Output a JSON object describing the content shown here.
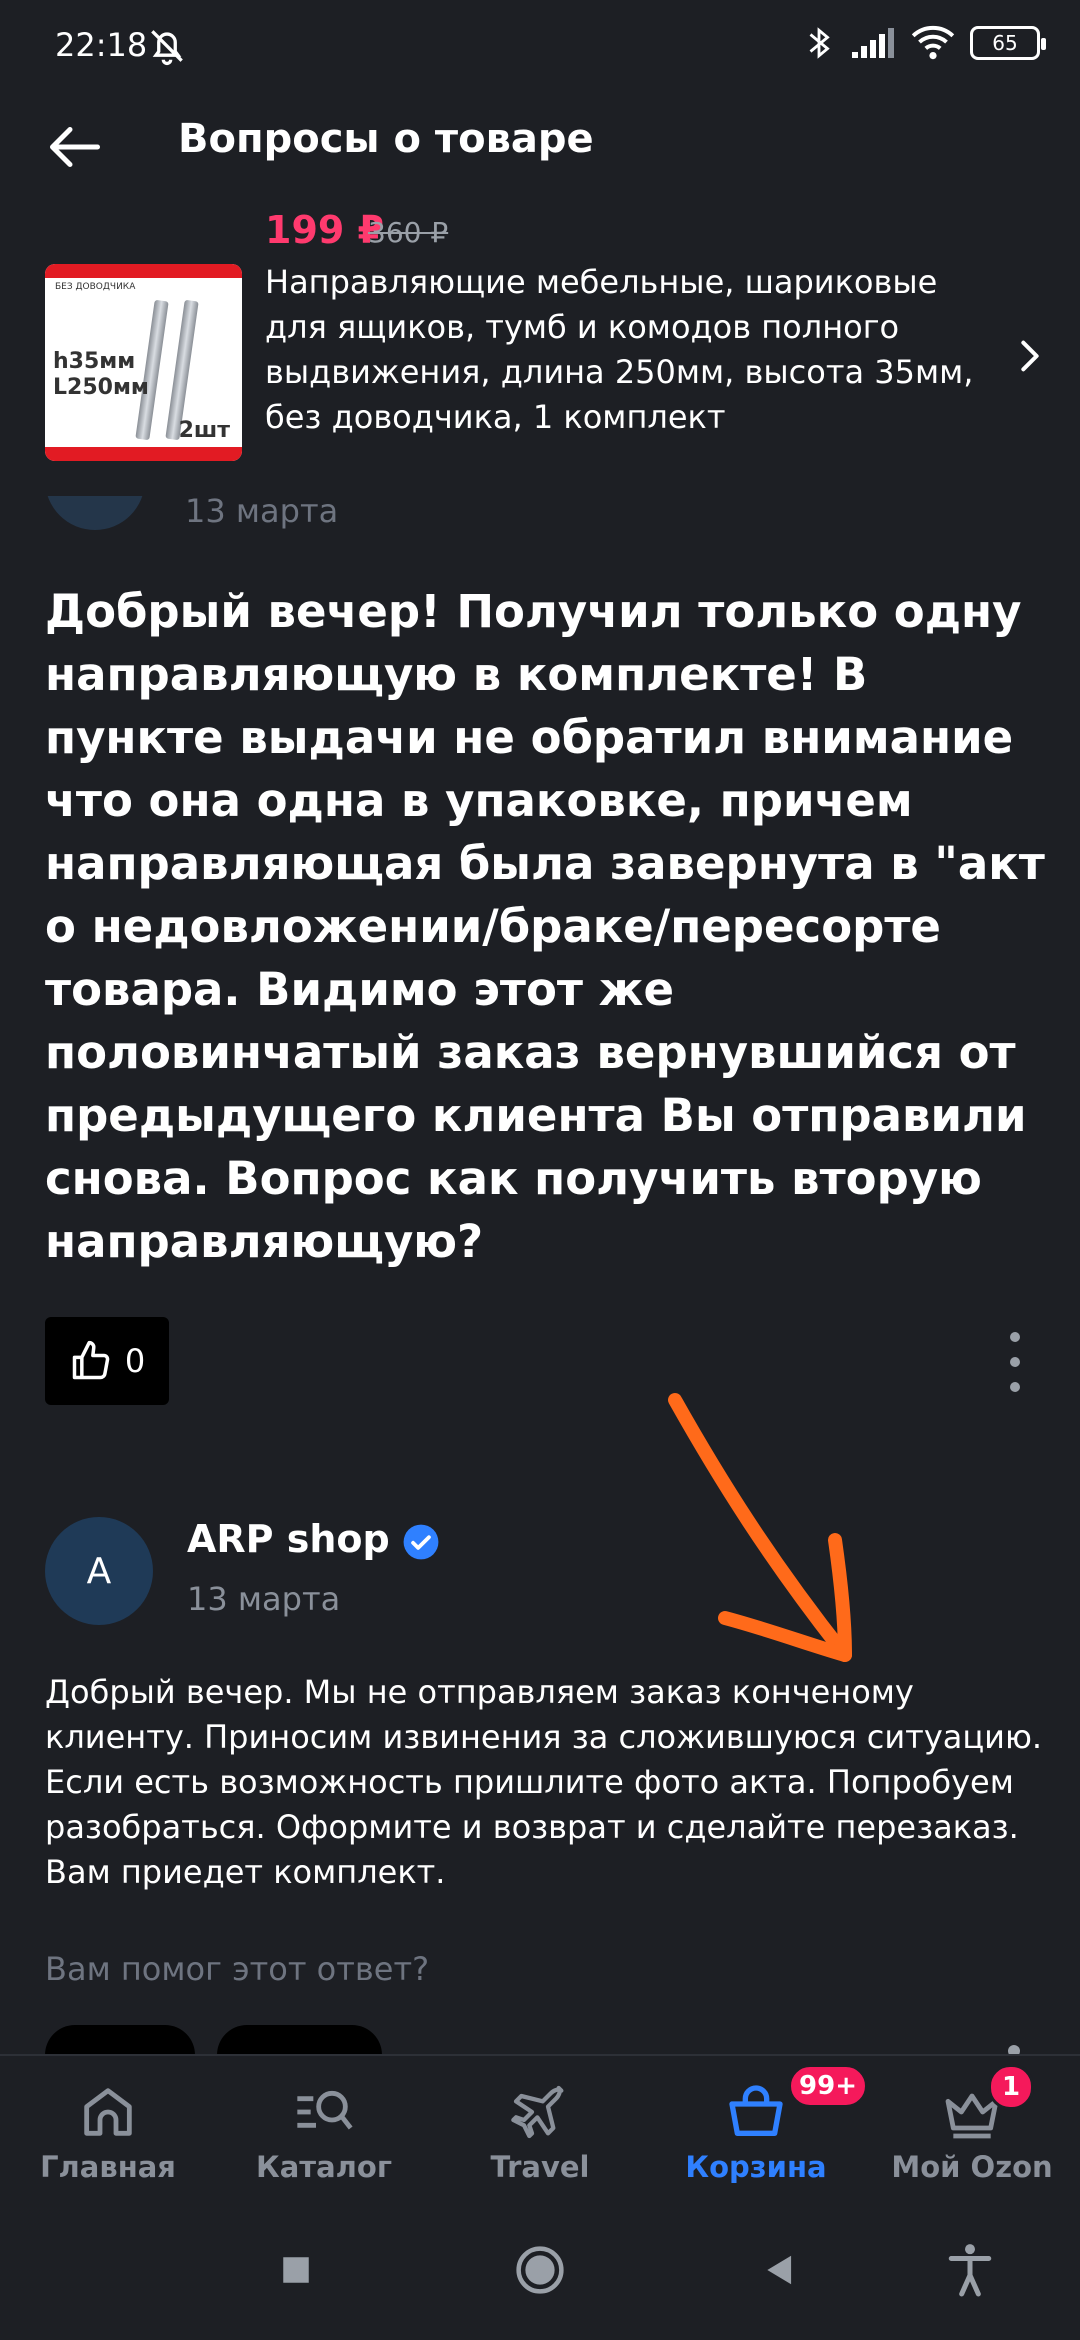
{
  "status_bar": {
    "time": "22:18",
    "battery": "65"
  },
  "header": {
    "title": "Вопросы о товаре"
  },
  "product": {
    "price": "199 ₽",
    "old_price": "360 ₽",
    "title": "Направляющие мебельные, шариковые для ящиков, тумб и комодов полного выдвижения, длина 250мм, высота 35мм, без доводчика,  1 комплект",
    "image_label": "БЕЗ ДОВОДЧИКА",
    "image_dim_h": "h35мм",
    "image_dim_l": "L250мм",
    "image_qty": "2шт"
  },
  "question": {
    "partial_date": "13 марта",
    "text": "Добрый вечер! Получил только одну направляющую в комплекте! В пункте выдачи не обратил внимание что она одна в упаковке, причем направляющая была завернута в \"акт о недовложении/браке/пересорте товара. Видимо этот же половинчатый заказ вернувшийся от предыдущего клиента Вы отправили снова. Вопрос как получить вторую направляющую?",
    "likes": "0"
  },
  "answer": {
    "avatar_letter": "A",
    "author": "ARP shop",
    "date": "13 марта",
    "text": "Добрый вечер. Мы не отправляем заказ конченому клиенту. Приносим извинения за сложившуюся ситуацию. Если есть возможность пришлите фото акта. Попробуем разобраться. Оформите и возврат и сделайте перезаказ. Вам приедет комплект.",
    "helpful_question": "Вам помог этот ответ?"
  },
  "bottom_nav": {
    "items": [
      {
        "label": "Главная",
        "icon": "home-icon"
      },
      {
        "label": "Каталог",
        "icon": "catalog-search-icon"
      },
      {
        "label": "Travel",
        "icon": "airplane-icon"
      },
      {
        "label": "Корзина",
        "icon": "basket-icon",
        "badge": "99+",
        "active": true
      },
      {
        "label": "Мой Ozon",
        "icon": "crown-icon",
        "badge": "1"
      }
    ]
  },
  "colors": {
    "background": "#1d1f24",
    "price": "#ff3a6e",
    "accent": "#2f80ff",
    "badge": "#f5195b",
    "annotation_arrow": "#ff6a1a"
  }
}
